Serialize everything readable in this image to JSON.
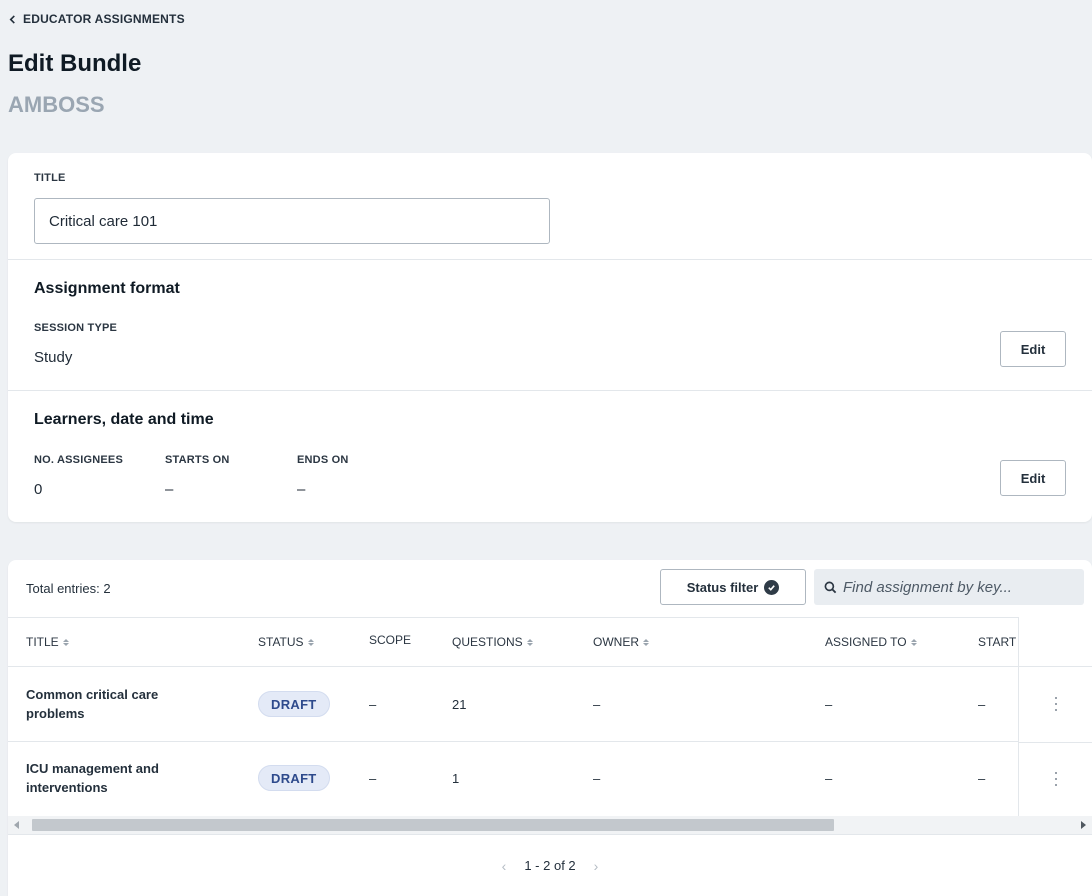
{
  "breadcrumb": {
    "label": "EDUCATOR ASSIGNMENTS"
  },
  "header": {
    "title": "Edit Bundle",
    "subtitle": "AMBOSS"
  },
  "bundle": {
    "title_label": "TITLE",
    "title_value": "Critical care 101",
    "format": {
      "heading": "Assignment format",
      "session_type_label": "SESSION TYPE",
      "session_type_value": "Study",
      "edit_label": "Edit"
    },
    "learners": {
      "heading": "Learners, date and time",
      "assignees_label": "NO. ASSIGNEES",
      "assignees_value": "0",
      "starts_label": "STARTS ON",
      "starts_value": "–",
      "ends_label": "ENDS ON",
      "ends_value": "–",
      "edit_label": "Edit"
    }
  },
  "table": {
    "total_entries": "Total entries: 2",
    "status_filter_label": "Status filter",
    "search_placeholder": "Find assignment by key...",
    "columns": {
      "title": "TITLE",
      "status": "STATUS",
      "scope": "SCOPE",
      "questions": "QUESTIONS",
      "owner": "OWNER",
      "assigned_to": "ASSIGNED TO",
      "start": "START"
    },
    "rows": [
      {
        "title": "Common critical care problems",
        "status": "DRAFT",
        "scope": "–",
        "questions": "21",
        "owner": "–",
        "assigned_to": "–",
        "start": "–"
      },
      {
        "title": "ICU management and interventions",
        "status": "DRAFT",
        "scope": "–",
        "questions": "1",
        "owner": "–",
        "assigned_to": "–",
        "start": "–"
      }
    ],
    "pagination": "1 - 2 of 2"
  },
  "colors": {
    "background": "#eef1f4",
    "badge_bg": "#e4eaf7",
    "badge_text": "#2e4a8c",
    "muted": "#9aa6b2"
  },
  "icons": [
    "chevron-left-icon",
    "check-circle-icon",
    "search-icon",
    "sort-icon",
    "kebab-menu-icon"
  ]
}
